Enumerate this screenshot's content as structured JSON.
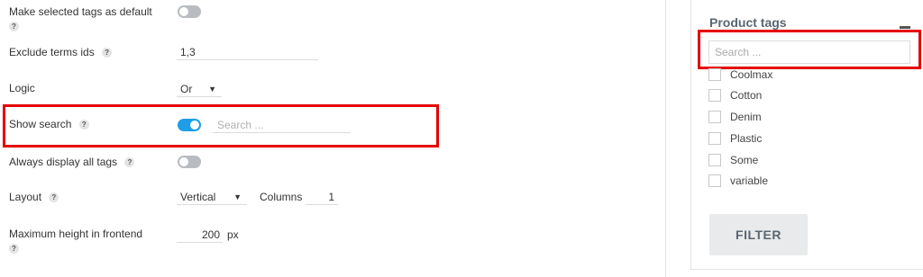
{
  "settings": {
    "make_default": {
      "label": "Make selected tags as default",
      "help": "?",
      "enabled": false
    },
    "exclude_terms": {
      "label": "Exclude terms ids",
      "help": "?",
      "value": "1,3"
    },
    "logic": {
      "label": "Logic",
      "value": "Or",
      "arrow": "▼"
    },
    "show_search": {
      "label": "Show search",
      "help": "?",
      "enabled": true,
      "placeholder": "Search ..."
    },
    "always_display": {
      "label": "Always display all tags",
      "help": "?",
      "enabled": false
    },
    "layout": {
      "label": "Layout",
      "help": "?",
      "value": "Vertical",
      "arrow": "▼",
      "columns_label": "Columns",
      "columns_value": "1"
    },
    "max_height": {
      "label": "Maximum height in frontend",
      "help": "?",
      "value": "200",
      "unit": "px"
    }
  },
  "widget": {
    "title": "Product tags",
    "search_placeholder": "Search ...",
    "tags": [
      "Coolmax",
      "Cotton",
      "Denim",
      "Plastic",
      "Some",
      "variable"
    ],
    "filter_label": "FILTER"
  },
  "colors": {
    "toggle_on": "#1e9ee6",
    "toggle_off": "#b8bcc0",
    "highlight": "#e60000"
  }
}
